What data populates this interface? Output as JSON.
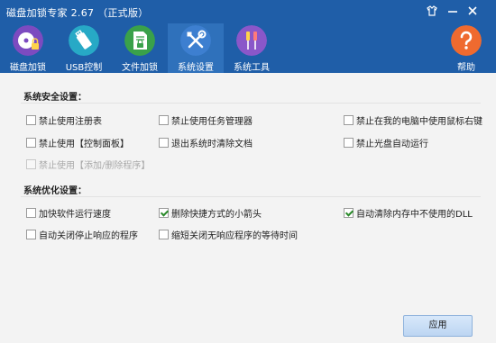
{
  "window": {
    "title": "磁盘加锁专家 2.67 （正式版）"
  },
  "toolbar": {
    "items": [
      {
        "label": "磁盘加锁",
        "icon": "disk-lock-icon",
        "color": "#7c4bc0"
      },
      {
        "label": "USB控制",
        "icon": "usb-icon",
        "color": "#27a9c6"
      },
      {
        "label": "文件加锁",
        "icon": "file-lock-icon",
        "color": "#3aa14a"
      },
      {
        "label": "系统设置",
        "icon": "tools-icon",
        "color": "#3d7fd0",
        "active": true
      },
      {
        "label": "系统工具",
        "icon": "screwdriver-icon",
        "color": "#8a57c9"
      },
      {
        "label": "帮助",
        "icon": "help-icon",
        "color": "#ef6a2f"
      }
    ]
  },
  "security": {
    "title": "系统安全设置：",
    "options": [
      {
        "label": "禁止使用注册表",
        "checked": false
      },
      {
        "label": "禁止使用任务管理器",
        "checked": false
      },
      {
        "label": "禁止在我的电脑中使用鼠标右键",
        "checked": false
      },
      {
        "label": "禁止使用【控制面板】",
        "checked": false
      },
      {
        "label": "退出系统时清除文档",
        "checked": false
      },
      {
        "label": "禁止光盘自动运行",
        "checked": false
      },
      {
        "label": "禁止使用【添加/删除程序】",
        "checked": false,
        "disabled": true
      }
    ]
  },
  "optimize": {
    "title": "系统优化设置：",
    "options": [
      {
        "label": "加快软件运行速度",
        "checked": false
      },
      {
        "label": "删除快捷方式的小箭头",
        "checked": true
      },
      {
        "label": "自动清除内存中不使用的DLL",
        "checked": true
      },
      {
        "label": "自动关闭停止响应的程序",
        "checked": false
      },
      {
        "label": "缩短关闭无响应程序的等待时间",
        "checked": false
      }
    ]
  },
  "apply_label": "应用"
}
